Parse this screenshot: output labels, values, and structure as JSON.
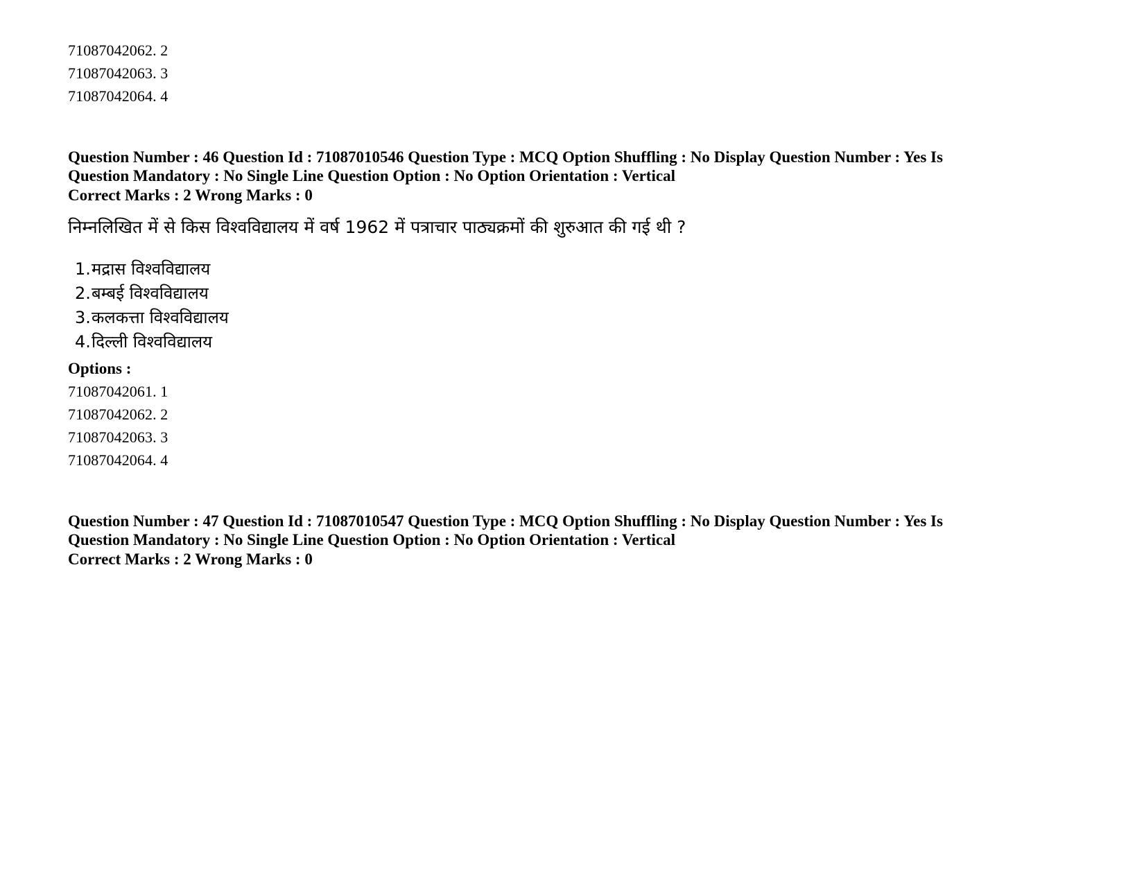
{
  "document": {
    "top_option_ids": [
      "71087042062. 2",
      "71087042063. 3",
      "71087042064. 4"
    ],
    "questions": [
      {
        "meta_line_1": "Question Number : 46 Question Id : 71087010546 Question Type : MCQ Option Shuffling : No Display Question Number : Yes Is",
        "meta_line_2": "Question Mandatory : No Single Line Question Option : No Option Orientation : Vertical",
        "marks_line": "Correct Marks : 2 Wrong Marks : 0",
        "question_text": "निम्नलिखित में से किस विश्वविद्यालय में वर्ष 1962 में पत्राचार पाठ्यक्रमों की शुरुआत की गई थी ?",
        "choices": [
          {
            "number": "1.",
            "text": "मद्रास विश्वविद्यालय"
          },
          {
            "number": "2.",
            "text": "बम्बई विश्वविद्यालय"
          },
          {
            "number": "3.",
            "text": "कलकत्ता विश्वविद्यालय"
          },
          {
            "number": "4.",
            "text": "दिल्ली विश्वविद्यालय"
          }
        ],
        "options_label": "Options :",
        "option_ids": [
          "71087042061. 1",
          "71087042062. 2",
          "71087042063. 3",
          "71087042064. 4"
        ]
      },
      {
        "meta_line_1": "Question Number : 47 Question Id : 71087010547 Question Type : MCQ Option Shuffling : No Display Question Number : Yes Is",
        "meta_line_2": "Question Mandatory : No Single Line Question Option : No Option Orientation : Vertical",
        "marks_line": "Correct Marks : 2 Wrong Marks : 0"
      }
    ]
  }
}
